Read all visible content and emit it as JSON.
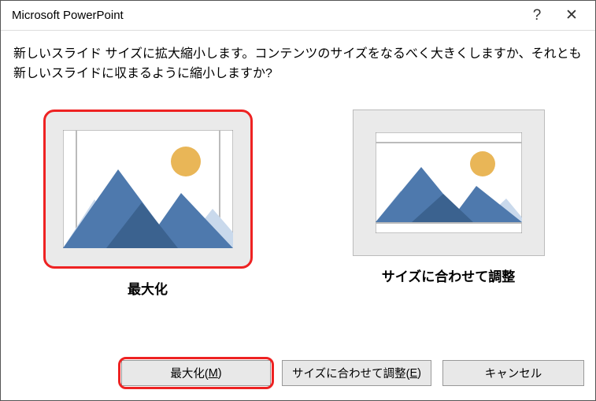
{
  "titlebar": {
    "title": "Microsoft PowerPoint",
    "help": "?",
    "close": "✕"
  },
  "prompt": "新しいスライド サイズに拡大縮小します。コンテンツのサイズをなるべく大きくしますか、それとも新しいスライドに収まるように縮小しますか?",
  "options": {
    "maximize": {
      "label": "最大化"
    },
    "fit": {
      "label": "サイズに合わせて調整"
    }
  },
  "buttons": {
    "maximize_pre": "最大化(",
    "maximize_key": "M",
    "maximize_post": ")",
    "fit_pre": "サイズに合わせて調整(",
    "fit_key": "E",
    "fit_post": ")",
    "cancel": "キャンセル"
  }
}
